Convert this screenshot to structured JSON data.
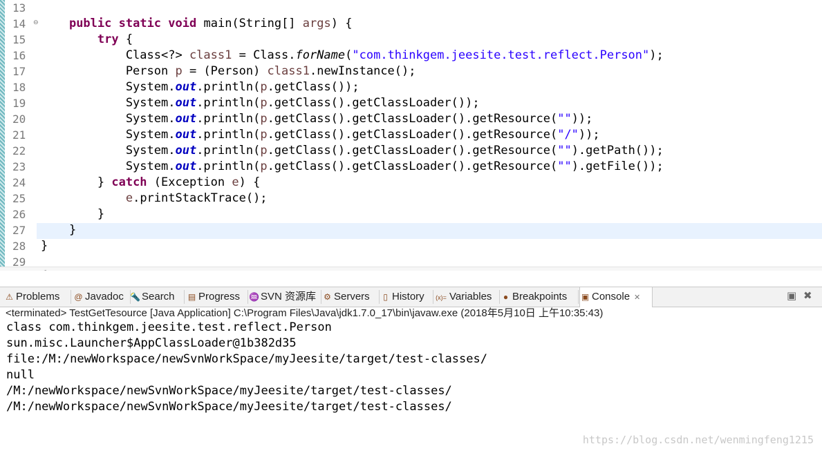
{
  "editor": {
    "line_numbers": [
      "13",
      "14",
      "15",
      "16",
      "17",
      "18",
      "19",
      "20",
      "21",
      "22",
      "23",
      "24",
      "25",
      "26",
      "27",
      "28",
      "29"
    ],
    "code_lines": [
      [],
      [
        {
          "t": "    "
        },
        {
          "t": "public",
          "c": "kw"
        },
        {
          "t": " "
        },
        {
          "t": "static",
          "c": "kw"
        },
        {
          "t": " "
        },
        {
          "t": "void",
          "c": "kw"
        },
        {
          "t": " main(String[] "
        },
        {
          "t": "args",
          "c": "var"
        },
        {
          "t": ") {"
        }
      ],
      [
        {
          "t": "        "
        },
        {
          "t": "try",
          "c": "kw"
        },
        {
          "t": " {"
        }
      ],
      [
        {
          "t": "            Class<?> "
        },
        {
          "t": "class1",
          "c": "var"
        },
        {
          "t": " = Class."
        },
        {
          "t": "forName",
          "c": "st"
        },
        {
          "t": "("
        },
        {
          "t": "\"com.thinkgem.jeesite.test.reflect.Person\"",
          "c": "str"
        },
        {
          "t": ");"
        }
      ],
      [
        {
          "t": "            Person "
        },
        {
          "t": "p",
          "c": "var"
        },
        {
          "t": " = (Person) "
        },
        {
          "t": "class1",
          "c": "var"
        },
        {
          "t": ".newInstance();"
        }
      ],
      [
        {
          "t": "            System."
        },
        {
          "t": "out",
          "c": "fld"
        },
        {
          "t": ".println("
        },
        {
          "t": "p",
          "c": "var"
        },
        {
          "t": ".getClass());"
        }
      ],
      [
        {
          "t": "            System."
        },
        {
          "t": "out",
          "c": "fld"
        },
        {
          "t": ".println("
        },
        {
          "t": "p",
          "c": "var"
        },
        {
          "t": ".getClass().getClassLoader());"
        }
      ],
      [
        {
          "t": "            System."
        },
        {
          "t": "out",
          "c": "fld"
        },
        {
          "t": ".println("
        },
        {
          "t": "p",
          "c": "var"
        },
        {
          "t": ".getClass().getClassLoader().getResource("
        },
        {
          "t": "\"\"",
          "c": "str"
        },
        {
          "t": "));"
        }
      ],
      [
        {
          "t": "            System."
        },
        {
          "t": "out",
          "c": "fld"
        },
        {
          "t": ".println("
        },
        {
          "t": "p",
          "c": "var"
        },
        {
          "t": ".getClass().getClassLoader().getResource("
        },
        {
          "t": "\"/\"",
          "c": "str"
        },
        {
          "t": "));"
        }
      ],
      [
        {
          "t": "            System."
        },
        {
          "t": "out",
          "c": "fld"
        },
        {
          "t": ".println("
        },
        {
          "t": "p",
          "c": "var"
        },
        {
          "t": ".getClass().getClassLoader().getResource("
        },
        {
          "t": "\"\"",
          "c": "str"
        },
        {
          "t": ").getPath());"
        }
      ],
      [
        {
          "t": "            System."
        },
        {
          "t": "out",
          "c": "fld"
        },
        {
          "t": ".println("
        },
        {
          "t": "p",
          "c": "var"
        },
        {
          "t": ".getClass().getClassLoader().getResource("
        },
        {
          "t": "\"\"",
          "c": "str"
        },
        {
          "t": ").getFile());"
        }
      ],
      [
        {
          "t": "        } "
        },
        {
          "t": "catch",
          "c": "kw"
        },
        {
          "t": " (Exception "
        },
        {
          "t": "e",
          "c": "var"
        },
        {
          "t": ") {"
        }
      ],
      [
        {
          "t": "            "
        },
        {
          "t": "e",
          "c": "var"
        },
        {
          "t": ".printStackTrace();"
        }
      ],
      [
        {
          "t": "        }"
        }
      ],
      [
        {
          "t": "    }"
        }
      ],
      [
        {
          "t": "}"
        }
      ],
      []
    ],
    "fold_marker": "⊖",
    "scroll_arrow": "<"
  },
  "tabs": [
    {
      "label": "Problems",
      "icon": "problems-icon",
      "glyph": "⚠"
    },
    {
      "label": "Javadoc",
      "icon": "javadoc-icon",
      "glyph": "@"
    },
    {
      "label": "Search",
      "icon": "search-icon",
      "glyph": "🔦"
    },
    {
      "label": "Progress",
      "icon": "progress-icon",
      "glyph": "▤"
    },
    {
      "label": "SVN 资源库",
      "icon": "svn-icon",
      "glyph": "♒"
    },
    {
      "label": "Servers",
      "icon": "servers-icon",
      "glyph": "⚙"
    },
    {
      "label": "History",
      "icon": "history-icon",
      "glyph": "▯"
    },
    {
      "label": "Variables",
      "icon": "variables-icon",
      "glyph": "(x)="
    },
    {
      "label": "Breakpoints",
      "icon": "breakpoints-icon",
      "glyph": "●"
    },
    {
      "label": "Console",
      "icon": "console-icon",
      "glyph": "▣",
      "active": true,
      "close": "✕"
    }
  ],
  "toolbar": {
    "clear_glyph": "▣",
    "remove_glyph": "✖"
  },
  "console": {
    "status": "<terminated> TestGetTesource [Java Application] C:\\Program Files\\Java\\jdk1.7.0_17\\bin\\javaw.exe (2018年5月10日 上午10:35:43)",
    "output": [
      "class com.thinkgem.jeesite.test.reflect.Person",
      "sun.misc.Launcher$AppClassLoader@1b382d35",
      "file:/M:/newWorkspace/newSvnWorkSpace/myJeesite/target/test-classes/",
      "null",
      "/M:/newWorkspace/newSvnWorkSpace/myJeesite/target/test-classes/",
      "/M:/newWorkspace/newSvnWorkSpace/myJeesite/target/test-classes/"
    ],
    "watermark": "https://blog.csdn.net/wenmingfeng1215"
  },
  "colors": {
    "keyword": "#7f0055",
    "string": "#2a00ff",
    "field": "#0000c0",
    "variable": "#6a3e3e",
    "current_line": "#e8f2fe"
  }
}
